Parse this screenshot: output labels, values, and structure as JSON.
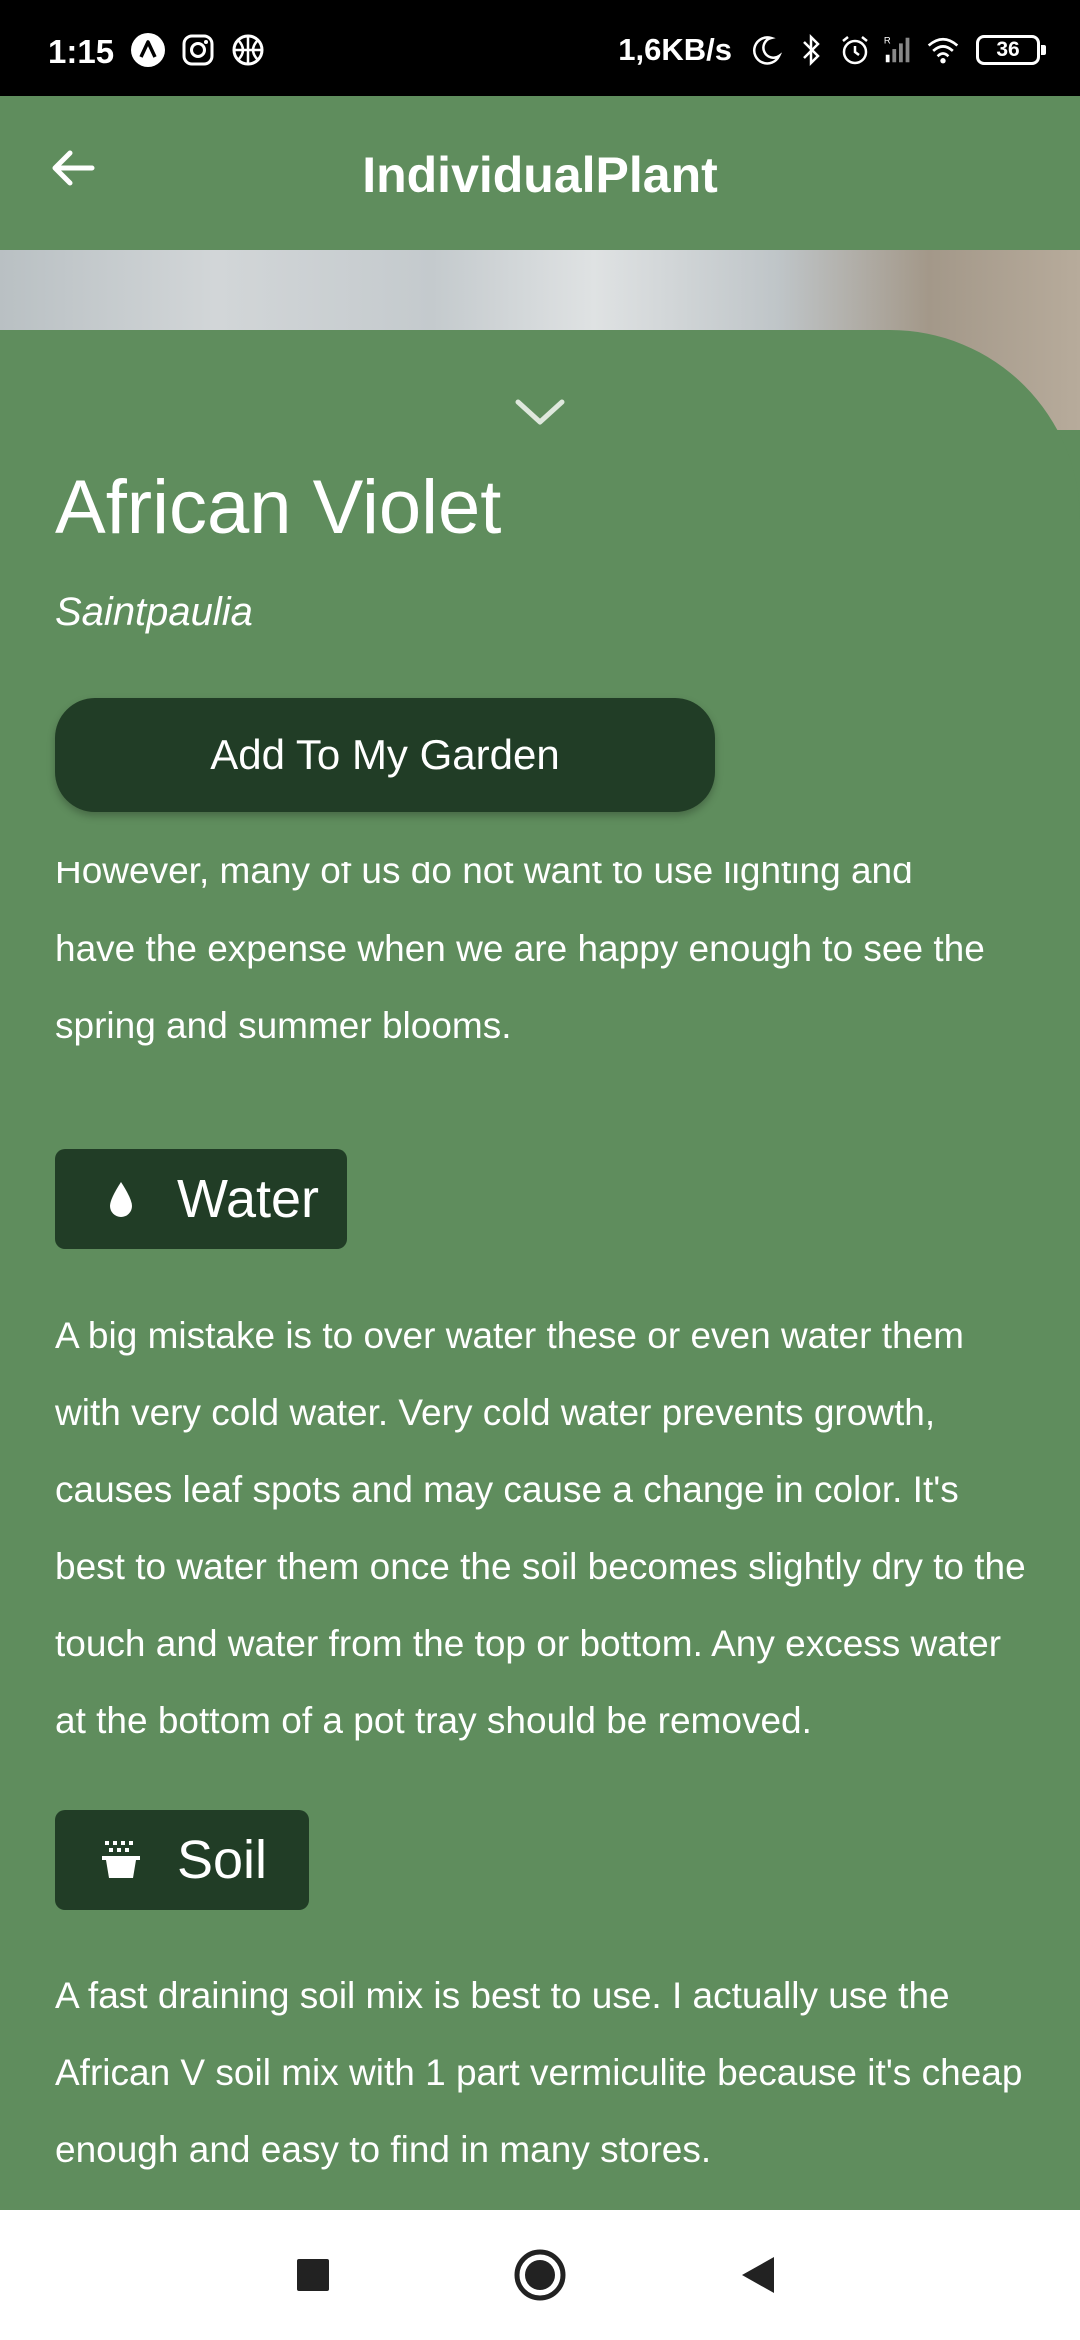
{
  "status_bar": {
    "time": "1:15",
    "left_icons": [
      "a-logo-icon",
      "instagram-icon",
      "basketball-icon"
    ],
    "network_speed": "1,6KB/s",
    "right_icons": [
      "moon-icon",
      "bluetooth-icon",
      "alarm-icon",
      "signal-icon",
      "wifi-icon"
    ],
    "battery_level": "36"
  },
  "app_bar": {
    "title": "IndividualPlant",
    "back_icon": "arrow-left-icon"
  },
  "plant": {
    "name": "African Violet",
    "scientific_name": "Saintpaulia",
    "add_button_label": "Add To My Garden"
  },
  "content": {
    "clipped_line": "However, many of us do not want to use lighting and",
    "light_text": "have the expense when we are happy enough to see the spring and summer blooms.",
    "sections": [
      {
        "title": "Water",
        "icon": "water-drop-icon",
        "text": "A big mistake is to over water these or even water them with very cold water. Very cold water prevents growth, causes leaf spots and may cause a change in color. It's best to water them once the soil becomes slightly dry to the touch and water from the top or bottom. Any excess water at the bottom of a pot tray should be removed."
      },
      {
        "title": "Soil",
        "icon": "soil-pot-icon",
        "text": "A fast draining soil mix is best to use. I actually use the African V soil mix with 1 part vermiculite because it's cheap enough and easy to find in many stores."
      }
    ]
  },
  "nav_bar": {
    "buttons": [
      "recents-square-icon",
      "home-circle-icon",
      "back-triangle-icon"
    ]
  },
  "colors": {
    "background_green": "#5f8d5d",
    "dark_green": "#213d26",
    "text_white": "#ffffff"
  }
}
